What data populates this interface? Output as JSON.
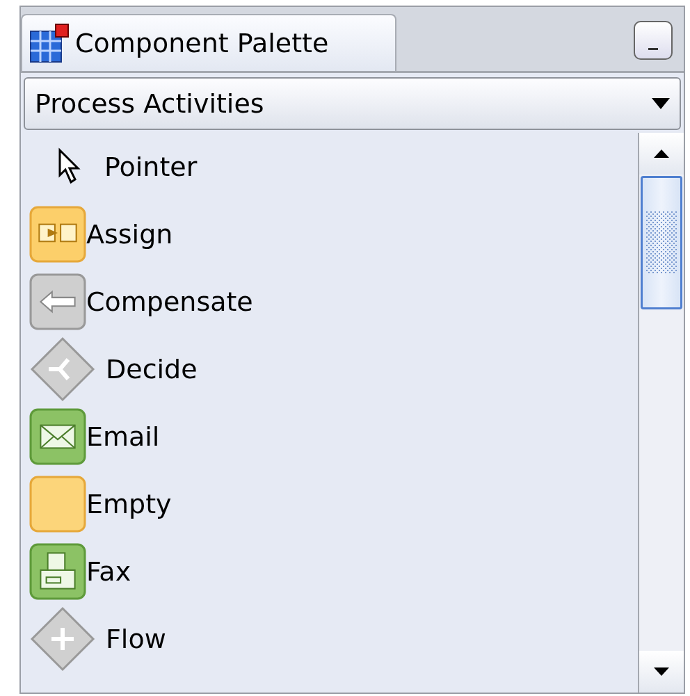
{
  "panel": {
    "title": "Component Palette"
  },
  "category": {
    "value": "Process Activities"
  },
  "items": [
    {
      "kind": "pointer",
      "label": "Pointer"
    },
    {
      "kind": "assign",
      "label": "Assign"
    },
    {
      "kind": "compensate",
      "label": "Compensate"
    },
    {
      "kind": "decide",
      "label": "Decide"
    },
    {
      "kind": "email",
      "label": "Email"
    },
    {
      "kind": "empty",
      "label": "Empty"
    },
    {
      "kind": "fax",
      "label": "Fax"
    },
    {
      "kind": "flow",
      "label": "Flow"
    }
  ]
}
